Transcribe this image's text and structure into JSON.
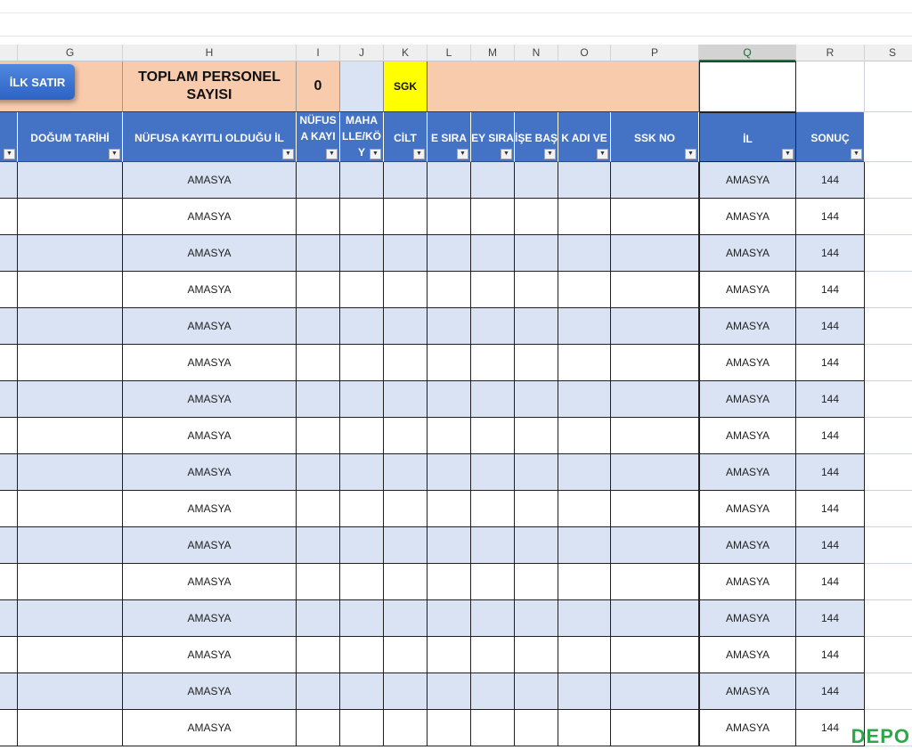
{
  "columns": [
    "G",
    "H",
    "I",
    "J",
    "K",
    "L",
    "M",
    "N",
    "O",
    "P",
    "Q",
    "R",
    "S"
  ],
  "selected_column": "Q",
  "top_row": {
    "ilk_satir_button": "İLK SATIR",
    "title": "TOPLAM PERSONEL SAYISI",
    "count": "0",
    "sgk": "SGK"
  },
  "headers": {
    "f": "",
    "g": "DOĞUM TARİHİ",
    "h": "NÜFUSA KAYITLI OLDUĞU İL",
    "i": "NÜFUS A KAYI",
    "j": "MAHA LLE/KÖ Y",
    "k": "CİLT",
    "l": "E SIRA",
    "m": "EY SIRA",
    "n": "İŞE BAŞ",
    "o": "K ADI VE",
    "p": "SSK NO",
    "q": "İL",
    "r": "SONUÇ"
  },
  "rows": [
    {
      "il_nufus": "AMASYA",
      "il": "AMASYA",
      "sonuc": "144"
    },
    {
      "il_nufus": "AMASYA",
      "il": "AMASYA",
      "sonuc": "144"
    },
    {
      "il_nufus": "AMASYA",
      "il": "AMASYA",
      "sonuc": "144"
    },
    {
      "il_nufus": "AMASYA",
      "il": "AMASYA",
      "sonuc": "144"
    },
    {
      "il_nufus": "AMASYA",
      "il": "AMASYA",
      "sonuc": "144"
    },
    {
      "il_nufus": "AMASYA",
      "il": "AMASYA",
      "sonuc": "144"
    },
    {
      "il_nufus": "AMASYA",
      "il": "AMASYA",
      "sonuc": "144"
    },
    {
      "il_nufus": "AMASYA",
      "il": "AMASYA",
      "sonuc": "144"
    },
    {
      "il_nufus": "AMASYA",
      "il": "AMASYA",
      "sonuc": "144"
    },
    {
      "il_nufus": "AMASYA",
      "il": "AMASYA",
      "sonuc": "144"
    },
    {
      "il_nufus": "AMASYA",
      "il": "AMASYA",
      "sonuc": "144"
    },
    {
      "il_nufus": "AMASYA",
      "il": "AMASYA",
      "sonuc": "144"
    },
    {
      "il_nufus": "AMASYA",
      "il": "AMASYA",
      "sonuc": "144"
    },
    {
      "il_nufus": "AMASYA",
      "il": "AMASYA",
      "sonuc": "144"
    },
    {
      "il_nufus": "AMASYA",
      "il": "AMASYA",
      "sonuc": "144"
    },
    {
      "il_nufus": "AMASYA",
      "il": "AMASYA",
      "sonuc": "144"
    }
  ],
  "watermark": "DEPO",
  "colors": {
    "header_blue": "#4472c4",
    "band_blue": "#dae3f3",
    "peach": "#f8cbad",
    "sgk_yellow": "#ffff00"
  }
}
